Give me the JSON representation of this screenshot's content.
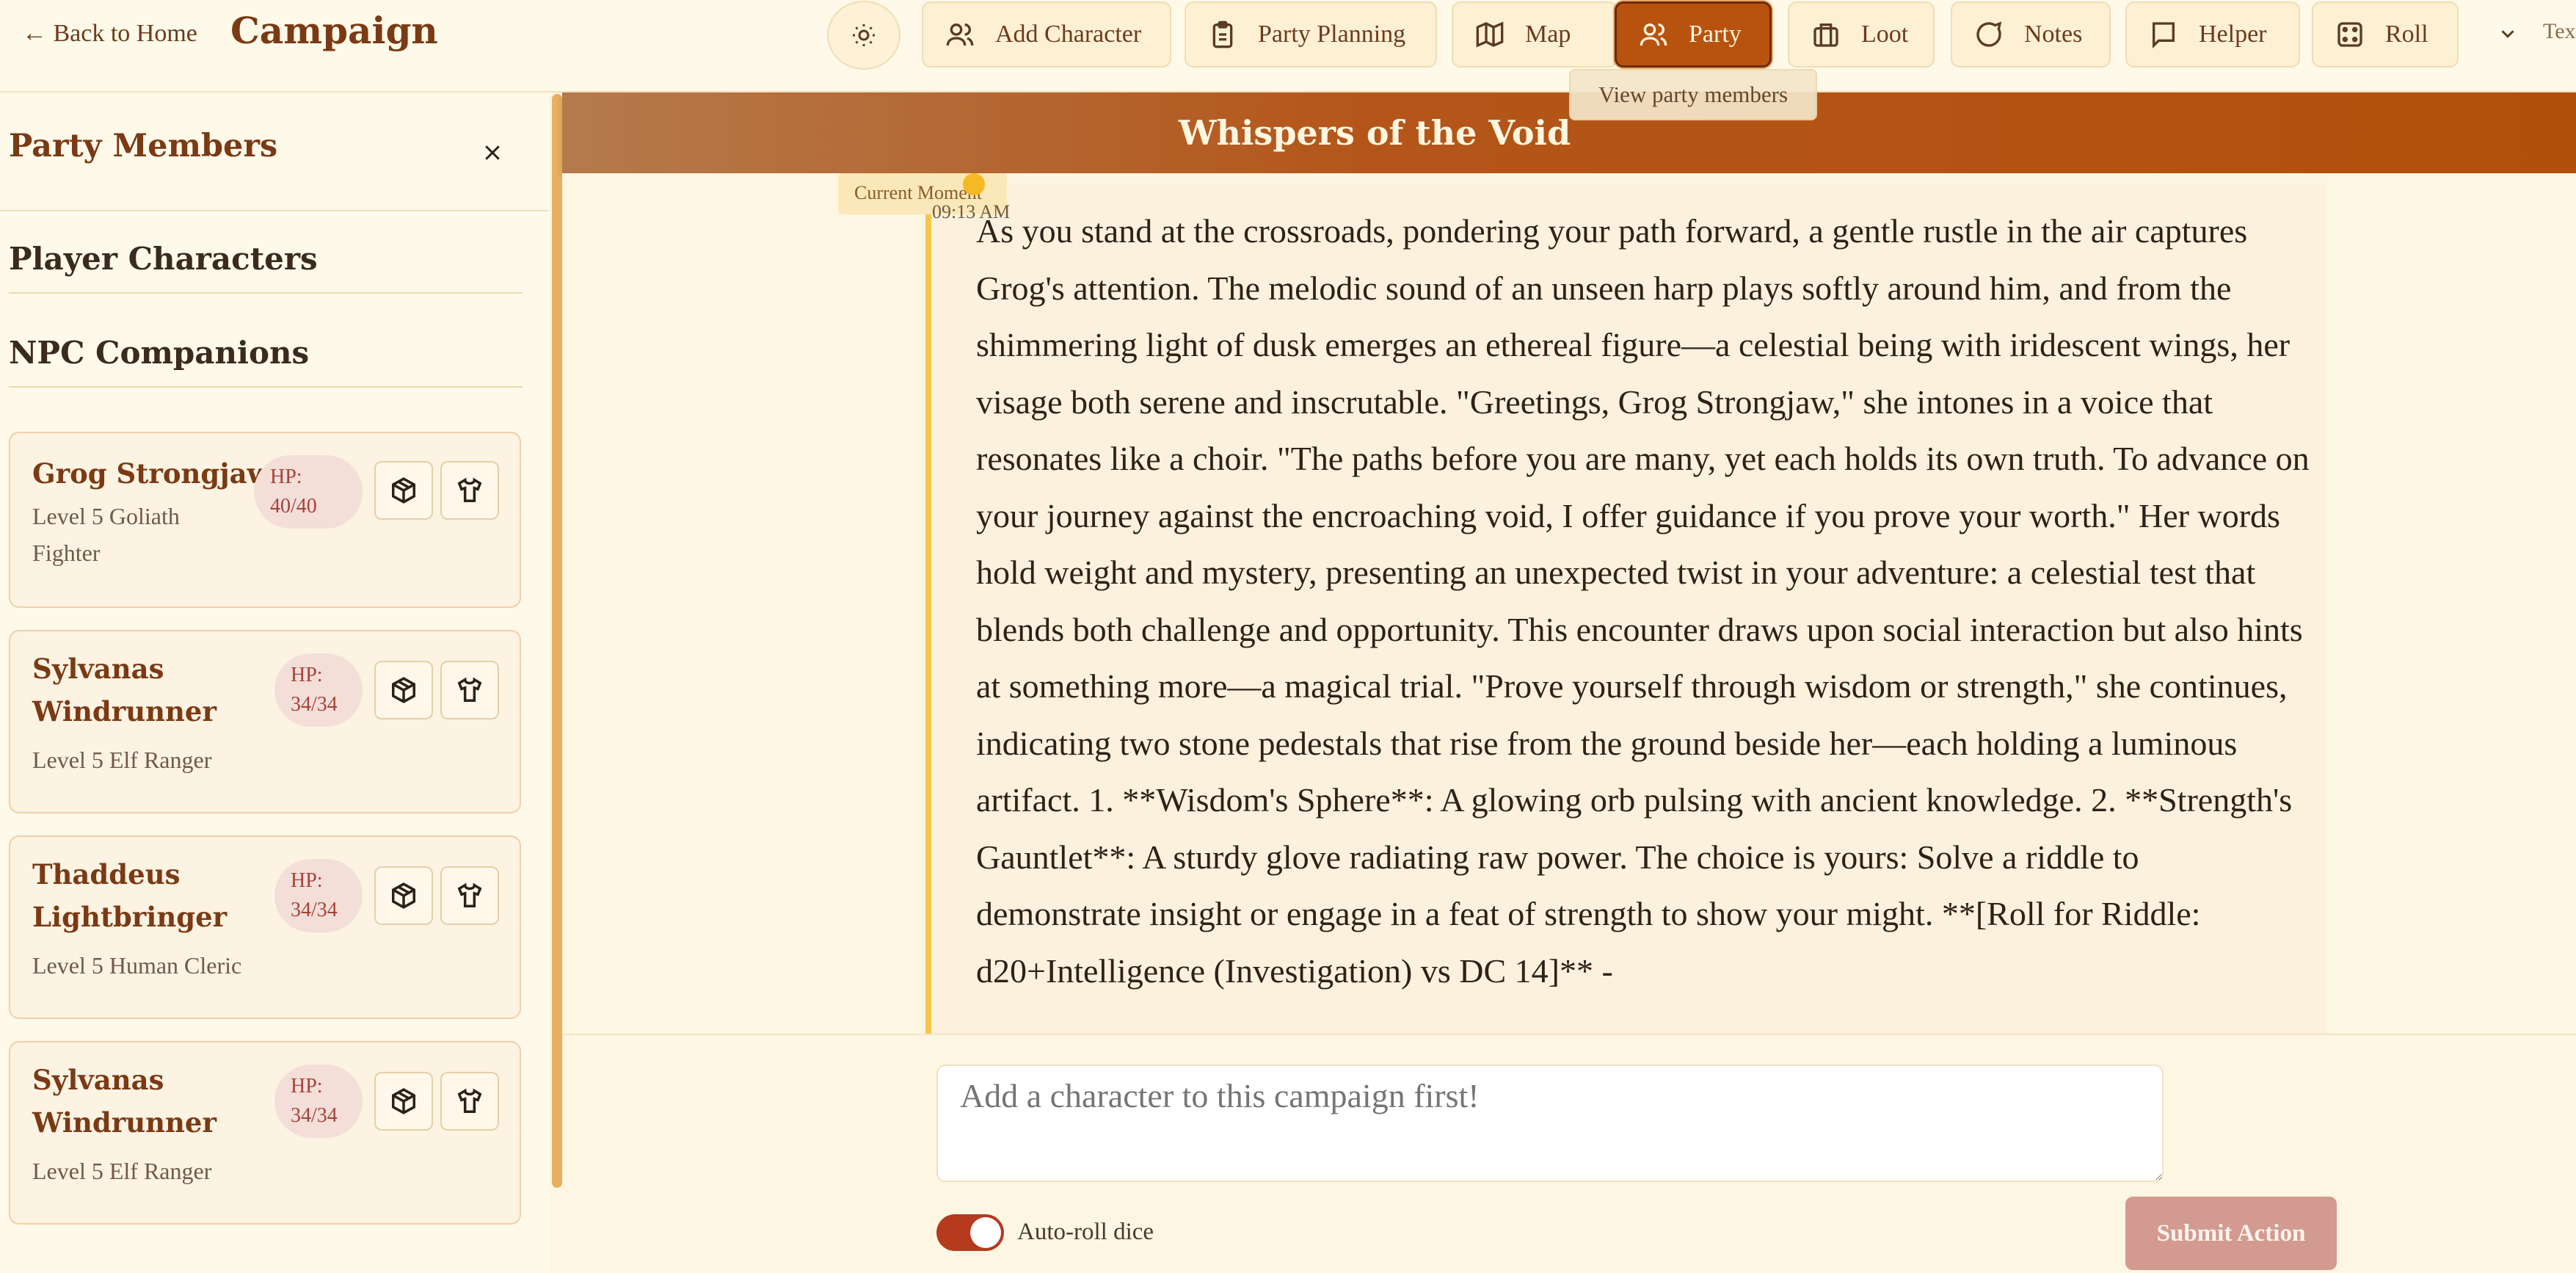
{
  "header": {
    "back_label": "← Back to Home",
    "title": "Campaign",
    "nav": [
      {
        "label": "Add Character",
        "icon": "users-icon"
      },
      {
        "label": "Party Planning",
        "icon": "clipboard-icon"
      },
      {
        "label": "Map",
        "icon": "map-icon"
      },
      {
        "label": "Party",
        "icon": "users-icon",
        "active": true
      },
      {
        "label": "Loot",
        "icon": "briefcase-icon"
      },
      {
        "label": "Notes",
        "icon": "message-circle-icon"
      },
      {
        "label": "Helper",
        "icon": "message-square-icon"
      },
      {
        "label": "Roll",
        "icon": "dice-icon"
      }
    ],
    "overflow_label": "Tex",
    "tooltip": "View party members"
  },
  "sidebar": {
    "title": "Party Members",
    "sections": {
      "players": "Player Characters",
      "npcs": "NPC Companions"
    },
    "members": [
      {
        "name": "Grog Strongjaw",
        "subtitle": "Level 5 Goliath Fighter",
        "hp_label": "HP:",
        "hp": "40/40"
      },
      {
        "name": "Sylvanas Windrunner",
        "subtitle": "Level 5 Elf Ranger",
        "hp_label": "HP:",
        "hp": "34/34"
      },
      {
        "name": "Thaddeus Lightbringer",
        "subtitle": "Level 5 Human Cleric",
        "hp_label": "HP:",
        "hp": "34/34"
      },
      {
        "name": "Sylvanas Windrunner",
        "subtitle": "Level 5 Elf Ranger",
        "hp_label": "HP:",
        "hp": "34/34"
      }
    ]
  },
  "main": {
    "banner_title": "Whispers of the Void",
    "moment_label": "Current Moment",
    "moment_time": "09:13 AM",
    "story": "As you stand at the crossroads, pondering your path forward, a gentle rustle in the air captures Grog's attention. The melodic sound of an unseen harp plays softly around him, and from the shimmering light of dusk emerges an ethereal figure—a celestial being with iridescent wings, her visage both serene and inscrutable. \"Greetings, Grog Strongjaw,\" she intones in a voice that resonates like a choir. \"The paths before you are many, yet each holds its own truth. To advance on your journey against the encroaching void, I offer guidance if you prove your worth.\" Her words hold weight and mystery, presenting an unexpected twist in your adventure: a celestial test that blends both challenge and opportunity. This encounter draws upon social interaction but also hints at something more—a magical trial. \"Prove yourself through wisdom or strength,\" she continues, indicating two stone pedestals that rise from the ground beside her—each holding a luminous artifact. 1. **Wisdom's Sphere**: A glowing orb pulsing with ancient knowledge. 2. **Strength's Gauntlet**: A sturdy glove radiating raw power. The choice is yours: Solve a riddle to demonstrate insight or engage in a feat of strength to show your might. **[Roll for Riddle: d20+Intelligence (Investigation) vs DC 14]** -",
    "input_placeholder": "Add a character to this campaign first!",
    "auto_roll_label": "Auto-roll dice",
    "auto_roll_on": true,
    "submit_label": "Submit Action"
  },
  "colors": {
    "accent": "#b8530f",
    "brand_text": "#7a3a14",
    "timeline": "#f6c84a",
    "hp_badge_bg": "#f3dfd8",
    "submit_bg": "#d29a90"
  }
}
